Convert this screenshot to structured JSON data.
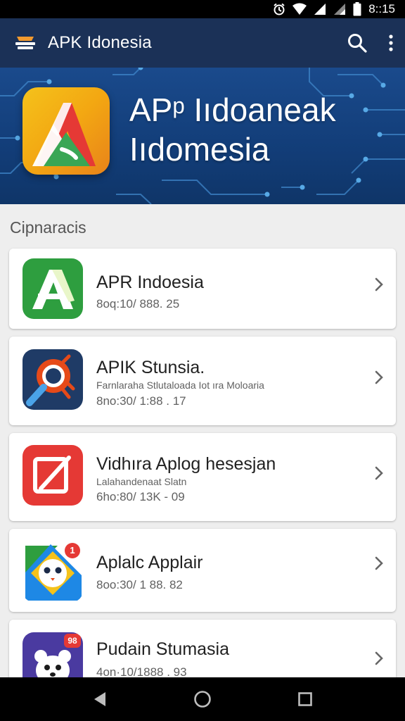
{
  "status_bar": {
    "time": "8::15",
    "icons": [
      "alarm-icon",
      "wifi-icon",
      "signal-icon",
      "signal-icon",
      "battery-icon"
    ]
  },
  "app_bar": {
    "title": "APK Idonesia",
    "logo_icon": "stack-logo-icon",
    "actions": [
      "search-icon",
      "more-vert-icon"
    ]
  },
  "banner": {
    "title_line1": "APᵖ Iıdoaneak",
    "title_line2": "Iıdomesia",
    "icon": "apk-logo-icon"
  },
  "section": {
    "title": "Cipnaracis"
  },
  "apps": [
    {
      "title": "APR Indoesia",
      "subtitle": "",
      "meta": "8oq:10/ 888. 25",
      "icon": "green-a-icon",
      "icon_color": "#2e9e3f"
    },
    {
      "title": "APIK Stunsia.",
      "subtitle": "Farnlaraha Stlutaloada Iot ıra Moloaria",
      "meta": "8no:30/ 1:88 . 17",
      "icon": "magnifier-icon",
      "icon_color": "#1f3b66"
    },
    {
      "title": "Vidhıra Aplog hesesjan",
      "subtitle": "Lalahandenaat Slatn",
      "meta": "6ho:80/ 13K - 09",
      "icon": "edit-square-icon",
      "icon_color": "#e53935"
    },
    {
      "title": "Aplalc Applair",
      "subtitle": "",
      "meta": "8oo:30/ 1 88. 82",
      "icon": "owl-face-icon",
      "icon_color": "#1e88e5",
      "badge": "1"
    },
    {
      "title": "Pudain Stumasia",
      "subtitle": "",
      "meta": "4on·10/1888 . 93",
      "icon": "panda-face-icon",
      "icon_color": "#4a3aa0",
      "badge": "98"
    }
  ],
  "nav_bar": {
    "buttons": [
      "back-icon",
      "home-icon",
      "recents-icon"
    ]
  }
}
